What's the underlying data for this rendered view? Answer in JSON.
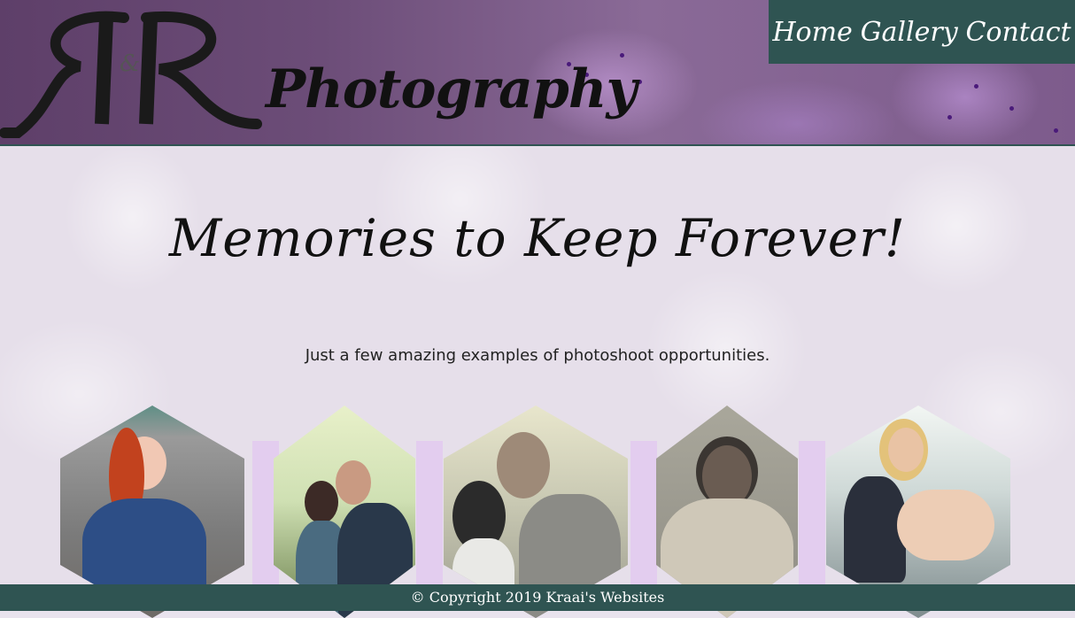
{
  "header": {
    "logo_letters": "R&R",
    "logo_word": "Photography"
  },
  "nav": {
    "home": "Home",
    "gallery": "Gallery",
    "contact": "Contact"
  },
  "main": {
    "headline": "Memories to Keep Forever!",
    "subtext": "Just a few amazing examples of photoshoot opportunities."
  },
  "gallery": [
    {
      "name": "portrait-redhead-woman"
    },
    {
      "name": "couple-kissing"
    },
    {
      "name": "wedding-couple"
    },
    {
      "name": "elderly-woman-portrait"
    },
    {
      "name": "blonde-woman-seated"
    }
  ],
  "footer": {
    "copyright": "© Copyright 2019 Kraai's Websites"
  },
  "colors": {
    "nav_bg": "#2f5452",
    "footer_bg": "#2f5452",
    "banner_purple": "#6c4d78",
    "accent_lilac": "#e3cdef"
  }
}
